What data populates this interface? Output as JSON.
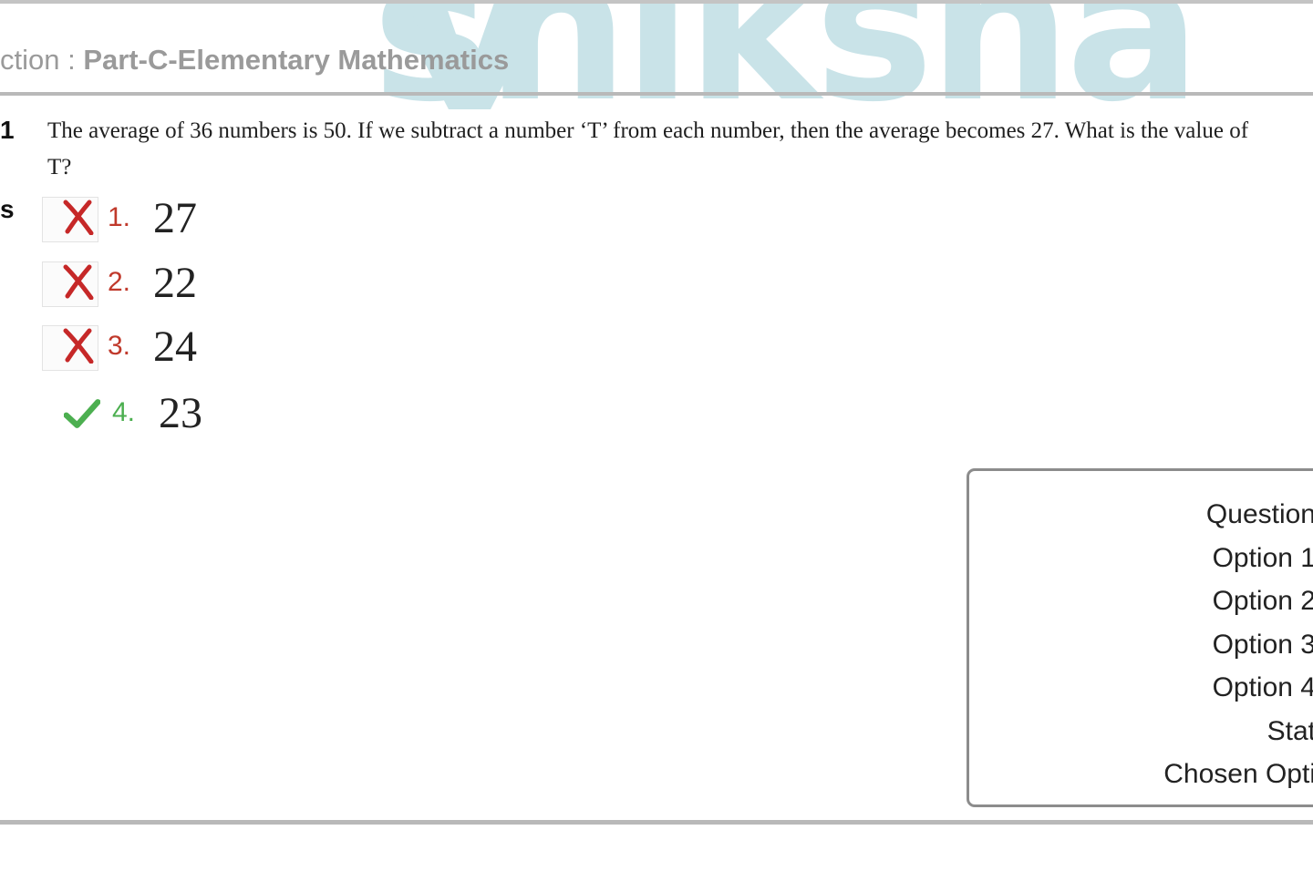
{
  "watermark": {
    "text": "shiksha"
  },
  "section": {
    "prefix": "ction : ",
    "name": "Part-C-Elementary Mathematics"
  },
  "question": {
    "number": "1",
    "status_fragment": "s",
    "text": "The average of 36 numbers is 50. If we subtract a number ‘T’ from each number, then the average becomes 27. What is the value of T?"
  },
  "options": [
    {
      "num": "1.",
      "value": "27",
      "icon": "cross-icon",
      "correct": false
    },
    {
      "num": "2.",
      "value": "22",
      "icon": "cross-icon",
      "correct": false
    },
    {
      "num": "3.",
      "value": "24",
      "icon": "cross-icon",
      "correct": false
    },
    {
      "num": "4.",
      "value": "23",
      "icon": "check-icon",
      "correct": true
    }
  ],
  "info_panel": {
    "labels": [
      "Question",
      "Option 1",
      "Option 2",
      "Option 3",
      "Option 4",
      "Stat",
      "Chosen Opti"
    ]
  },
  "colors": {
    "wrong": "#c0392b",
    "right": "#4caf50",
    "watermark": "#c9e3e8"
  }
}
